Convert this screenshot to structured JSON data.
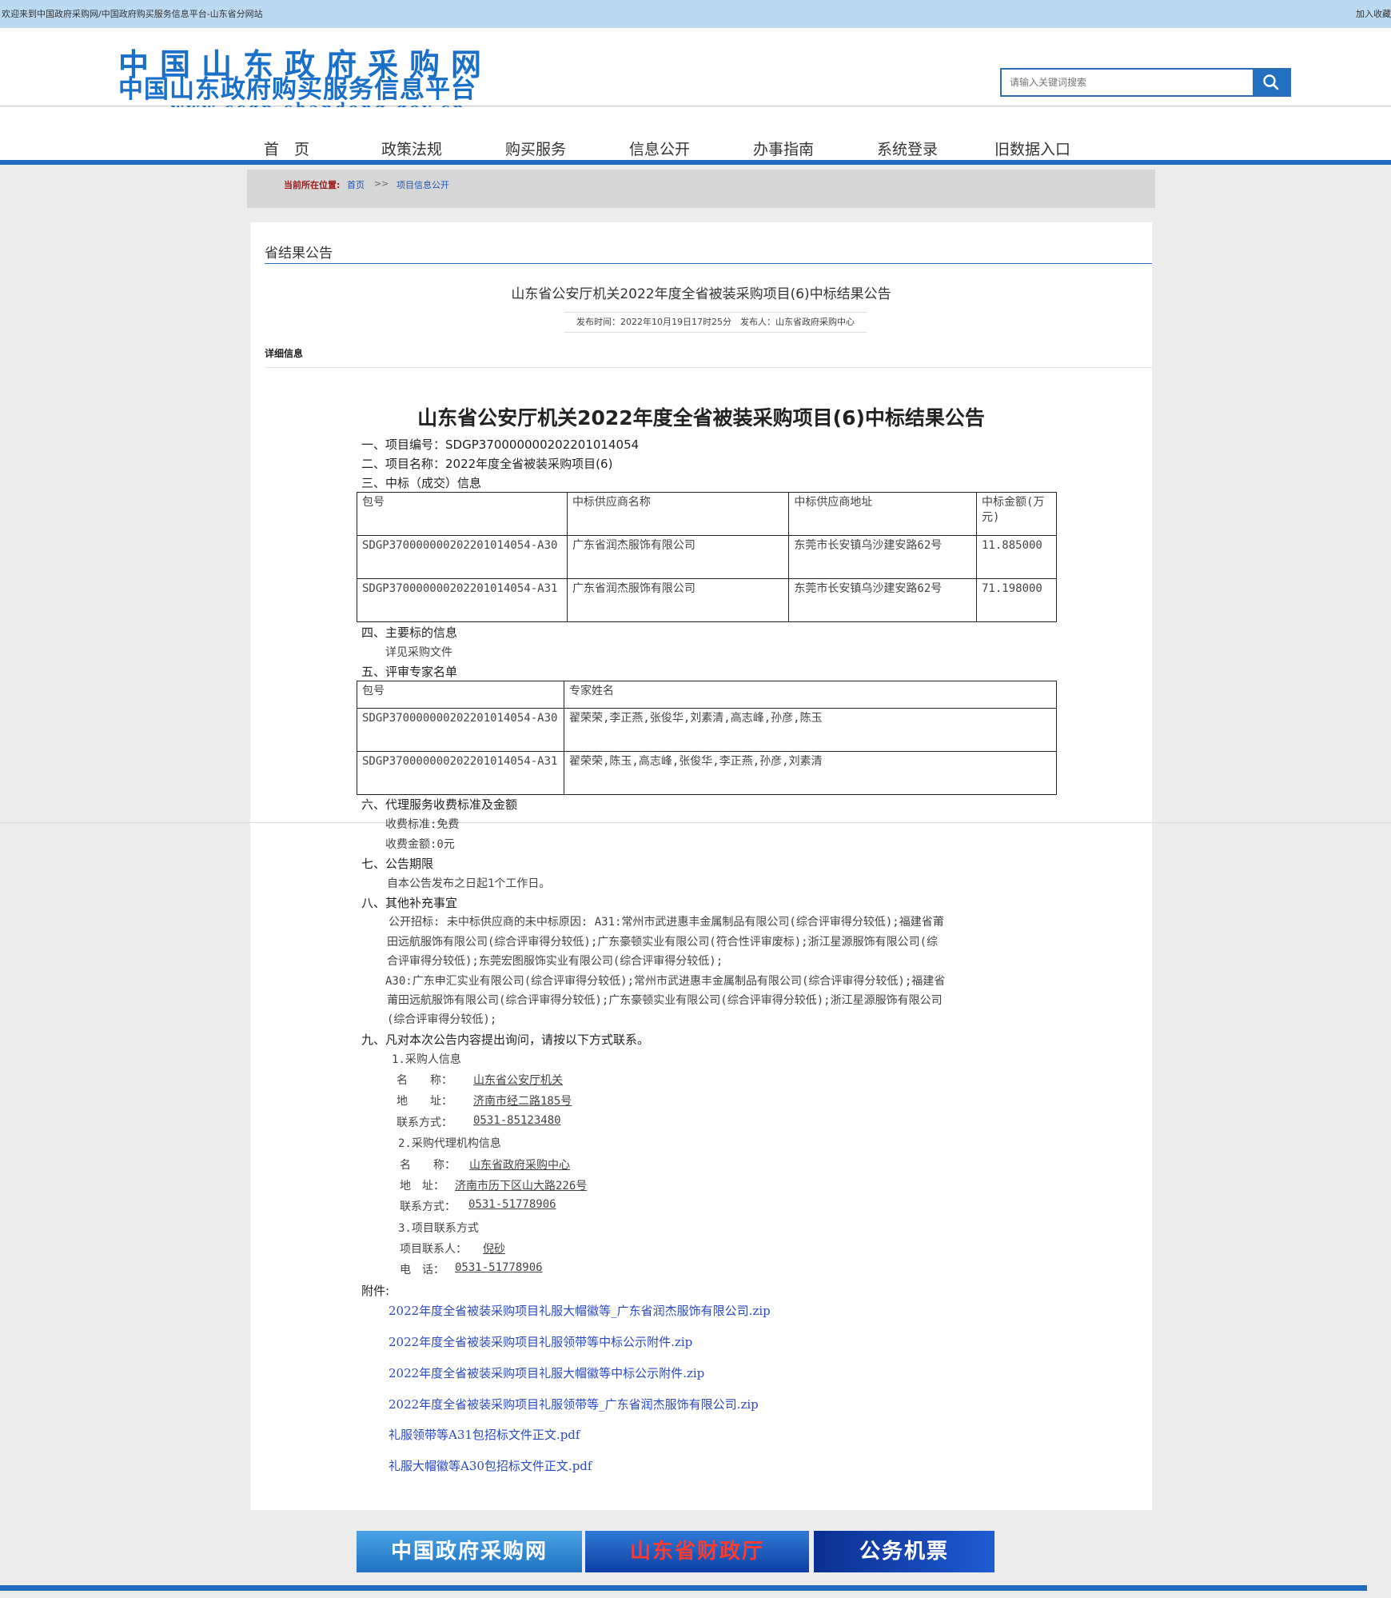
{
  "topbar": {
    "welcome": "欢迎来到中国政府采购网/中国政府购买服务信息平台-山东省分网站",
    "favorite": "加入收藏"
  },
  "header": {
    "logo_line1": "中国山东政府采购网",
    "logo_line2": "中国山东政府购买服务信息平台",
    "logo_url": "www.ccgp-shandong.gov.cn",
    "search_placeholder": "请输入关键词搜索",
    "search_icon": "search-icon"
  },
  "nav": {
    "items": [
      "首　页",
      "政策法规",
      "购买服务",
      "信息公开",
      "办事指南",
      "系统登录",
      "旧数据入口"
    ]
  },
  "breadcrumb": {
    "label": "当前所在位置:",
    "home": "首页",
    "sep": ">>",
    "current": "项目信息公开"
  },
  "panel": {
    "category": "省结果公告",
    "title": "山东省公安厅机关2022年度全省被装采购项目(6)中标结果公告",
    "meta": "发布时间：2022年10月19日17时25分　发布人：山东省政府采购中心",
    "detail_label": "详细信息"
  },
  "doc": {
    "title": "山东省公安厅机关2022年度全省被装采购项目(6)中标结果公告",
    "s1": "一、项目编号：SDGP370000000202201014054",
    "s2": "二、项目名称：2022年度全省被装采购项目(6)",
    "s3": "三、中标（成交）信息",
    "award_headers": [
      "包号",
      "中标供应商名称",
      "中标供应商地址",
      "中标金额(万元)"
    ],
    "award_rows": [
      [
        "SDGP370000000202201014054-A30",
        "广东省润杰服饰有限公司",
        "东莞市长安镇乌沙建安路62号",
        "11.885000"
      ],
      [
        "SDGP370000000202201014054-A31",
        "广东省润杰服饰有限公司",
        "东莞市长安镇乌沙建安路62号",
        "71.198000"
      ]
    ],
    "s4": "四、主要标的信息",
    "s4_text": "详见采购文件",
    "s5": "五、评审专家名单",
    "expert_headers": [
      "包号",
      "专家姓名"
    ],
    "expert_rows": [
      [
        "SDGP370000000202201014054-A30",
        "翟荣荣,李正燕,张俊华,刘素清,高志峰,孙彦,陈玉"
      ],
      [
        "SDGP370000000202201014054-A31",
        "翟荣荣,陈玉,高志峰,张俊华,李正燕,孙彦,刘素清"
      ]
    ],
    "s6": "六、代理服务收费标准及金额",
    "s6_l1": "收费标准:免费",
    "s6_l2": "收费金额:0元",
    "s7": "七、公告期限",
    "s7_text": "自本公告发布之日起1个工作日。",
    "s8": "八、其他补充事宜",
    "s8_lines": [
      "公开招标: 未中标供应商的未中标原因: A31:常州市武进惠丰金属制品有限公司(综合评审得分较低);福建省莆",
      "田远航服饰有限公司(综合评审得分较低);广东豪顿实业有限公司(符合性评审废标);浙江星源服饰有限公司(综",
      "合评审得分较低);东莞宏图服饰实业有限公司(综合评审得分较低);",
      "A30:广东申汇实业有限公司(综合评审得分较低);常州市武进惠丰金属制品有限公司(综合评审得分较低);福建省",
      "莆田远航服饰有限公司(综合评审得分较低);广东豪顿实业有限公司(综合评审得分较低);浙江星源服饰有限公司",
      "(综合评审得分较低);"
    ],
    "s9": "九、凡对本次公告内容提出询问，请按以下方式联系。",
    "c1_title": "1.采购人信息",
    "c1_name_lbl": "名　　称：",
    "c1_name": "山东省公安厅机关",
    "c1_addr_lbl": "地　　址：",
    "c1_addr": "济南市经二路185号",
    "c1_tel_lbl": "联系方式：",
    "c1_tel": "0531-85123480",
    "c2_title": "2.采购代理机构信息",
    "c2_name_lbl": "名　　称：",
    "c2_name": "山东省政府采购中心",
    "c2_addr_lbl": "地　址：",
    "c2_addr": "济南市历下区山大路226号",
    "c2_tel_lbl": "联系方式：",
    "c2_tel": "0531-51778906",
    "c3_title": "3.项目联系方式",
    "c3_person_lbl": "项目联系人：",
    "c3_person": "倪砂",
    "c3_tel_lbl": "电　话：",
    "c3_tel": "0531-51778906",
    "attach_label": "附件:",
    "attachments": [
      "2022年度全省被装采购项目礼服大帽徽等_广东省润杰服饰有限公司.zip",
      "2022年度全省被装采购项目礼服领带等中标公示附件.zip",
      "2022年度全省被装采购项目礼服大帽徽等中标公示附件.zip",
      "2022年度全省被装采购项目礼服领带等_广东省润杰服饰有限公司.zip",
      "礼服领带等A31包招标文件正文.pdf",
      "礼服大帽徽等A30包招标文件正文.pdf"
    ]
  },
  "footer": {
    "links": [
      "中国政府采购网",
      "山东省财政厅",
      "公务机票"
    ]
  },
  "colors": {
    "brand_blue": "#1f6cc0",
    "link_blue": "#2b48c4",
    "topbar": "#bcd9f2"
  }
}
